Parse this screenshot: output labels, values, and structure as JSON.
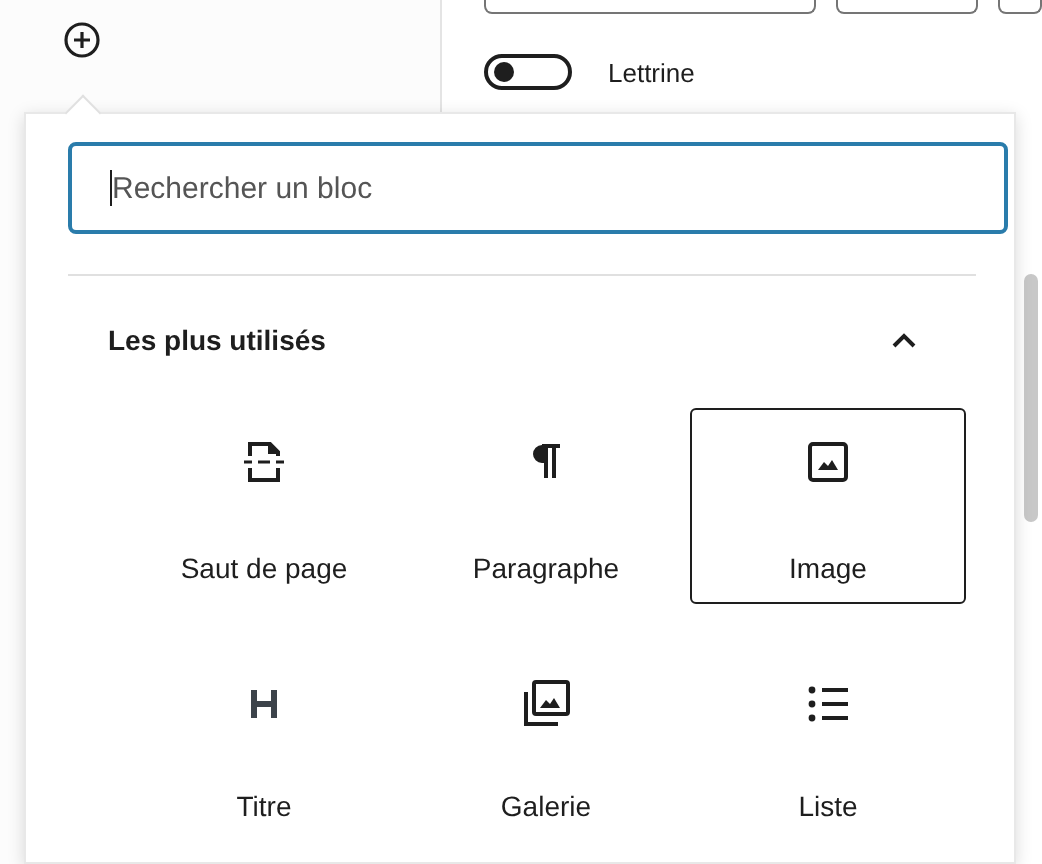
{
  "background": {
    "setting_label": "Lettrine",
    "setting_on": false
  },
  "inserter": {
    "search": {
      "placeholder": "Rechercher un bloc"
    },
    "section": {
      "title": "Les plus utilisés",
      "expanded": true
    },
    "blocks": [
      {
        "kind": "page-break",
        "label": "Saut de page",
        "selected": false
      },
      {
        "kind": "paragraph",
        "label": "Paragraphe",
        "selected": false
      },
      {
        "kind": "image",
        "label": "Image",
        "selected": true
      },
      {
        "kind": "heading",
        "label": "Titre",
        "selected": false
      },
      {
        "kind": "gallery",
        "label": "Galerie",
        "selected": false
      },
      {
        "kind": "list",
        "label": "Liste",
        "selected": false
      }
    ]
  }
}
